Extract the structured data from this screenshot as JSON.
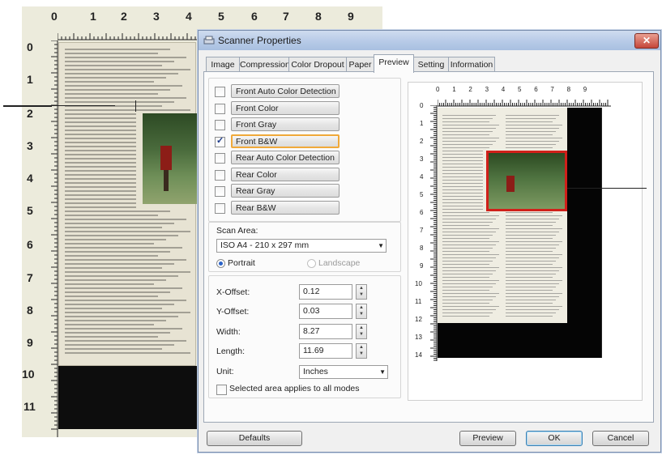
{
  "background_ruler": {
    "top_numbers": [
      "0",
      "1",
      "2",
      "3",
      "4",
      "5",
      "6",
      "7",
      "8",
      "9"
    ],
    "left_numbers": [
      "0",
      "1",
      "2",
      "3",
      "4",
      "5",
      "6",
      "7",
      "8",
      "9",
      "10",
      "11"
    ]
  },
  "dialog": {
    "title": "Scanner Properties",
    "close_icon": "close-x",
    "tabs": [
      {
        "label": "Image"
      },
      {
        "label": "Compression"
      },
      {
        "label": "Color Dropout"
      },
      {
        "label": "Paper"
      },
      {
        "label": "Preview"
      },
      {
        "label": "Setting"
      },
      {
        "label": "Information"
      }
    ],
    "active_tab": "Preview",
    "image_options": [
      {
        "label": "Front Auto Color Detection",
        "checked": false
      },
      {
        "label": "Front Color",
        "checked": false
      },
      {
        "label": "Front Gray",
        "checked": false
      },
      {
        "label": "Front B&W",
        "checked": true
      },
      {
        "label": "Rear Auto Color Detection",
        "checked": false
      },
      {
        "label": "Rear Color",
        "checked": false
      },
      {
        "label": "Rear Gray",
        "checked": false
      },
      {
        "label": "Rear B&W",
        "checked": false
      }
    ],
    "scan_area": {
      "label": "Scan Area:",
      "value": "ISO A4 - 210 x 297 mm",
      "portrait_label": "Portrait",
      "landscape_label": "Landscape",
      "orientation": "Portrait"
    },
    "fields": {
      "x_offset": {
        "label": "X-Offset:",
        "value": "0.12"
      },
      "y_offset": {
        "label": "Y-Offset:",
        "value": "0.03"
      },
      "width": {
        "label": "Width:",
        "value": "8.27"
      },
      "length": {
        "label": "Length:",
        "value": "11.69"
      },
      "unit": {
        "label": "Unit:",
        "value": "Inches"
      }
    },
    "selected_area_all_modes": {
      "label": "Selected area applies to all modes",
      "checked": false
    },
    "preview_ruler": {
      "top_numbers": [
        "0",
        "1",
        "2",
        "3",
        "4",
        "5",
        "6",
        "7",
        "8",
        "9"
      ],
      "left_numbers": [
        "0",
        "1",
        "2",
        "3",
        "4",
        "5",
        "6",
        "7",
        "8",
        "9",
        "10",
        "11",
        "12",
        "13",
        "14"
      ]
    },
    "buttons": {
      "defaults": "Defaults",
      "preview": "Preview",
      "ok": "OK",
      "cancel": "Cancel"
    }
  },
  "colors": {
    "accent_highlight": "#f0a93a",
    "selection_red": "#d0201a",
    "title_bar": "#b9cce8"
  }
}
